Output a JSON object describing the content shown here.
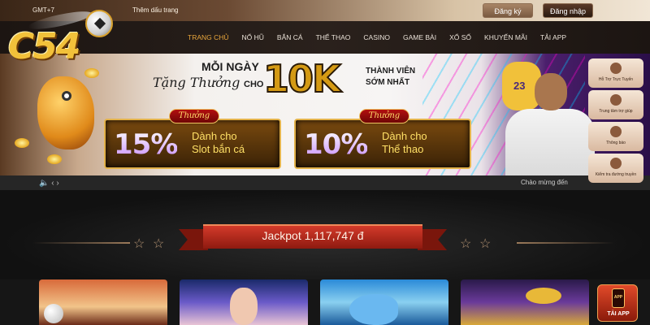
{
  "topbar": {
    "gmt": "GMT+7",
    "bookmark_label": "Thêm dấu trang",
    "register_label": "Đăng ký",
    "login_label": "Đăng nhập"
  },
  "logo": {
    "text": "C54"
  },
  "nav": {
    "items": [
      {
        "label": "TRANG CHỦ",
        "active": true
      },
      {
        "label": "NỔ HŨ"
      },
      {
        "label": "BẮN CÁ"
      },
      {
        "label": "THỂ THAO"
      },
      {
        "label": "CASINO"
      },
      {
        "label": "GAME BÀI"
      },
      {
        "label": "XỔ SỐ"
      },
      {
        "label": "KHUYẾN MÃI"
      },
      {
        "label": "TẢI APP"
      }
    ]
  },
  "banner": {
    "line1": "MỖI NGÀY",
    "line2": "Tặng Thưởng",
    "cho": "CHO",
    "big": "10K",
    "line3a": "THÀNH VIÊN",
    "line3b": "SỚM NHẤT",
    "player_number": "23",
    "cards": [
      {
        "tag": "Thưởng",
        "percent": "15%",
        "desc1": "Dành cho",
        "desc2": "Slot bắn cá"
      },
      {
        "tag": "Thưởng",
        "percent": "10%",
        "desc1": "Dành cho",
        "desc2": "Thể thao"
      }
    ]
  },
  "side_widget": [
    {
      "label": "Hỗ Trợ Trực Tuyến",
      "icon": "chat-icon"
    },
    {
      "label": "Trung tâm trợ giúp",
      "icon": "help-book-icon"
    },
    {
      "label": "Thông báo",
      "icon": "bell-icon"
    },
    {
      "label": "Kiểm tra đường truyền",
      "icon": "network-icon"
    }
  ],
  "marquee": {
    "text": "Chào mừng đến"
  },
  "jackpot": {
    "label": "Jackpot",
    "amount": "1,117,747 đ"
  },
  "games": [
    {
      "name": "game-sports",
      "icon": "football-icon"
    },
    {
      "name": "game-casino",
      "icon": "dealer-icon"
    },
    {
      "name": "game-fishing",
      "icon": "fish-icon"
    },
    {
      "name": "game-slots",
      "icon": "lamp-icon"
    }
  ],
  "app_badge": {
    "phone_text": "APP",
    "label": "TẢI APP"
  }
}
